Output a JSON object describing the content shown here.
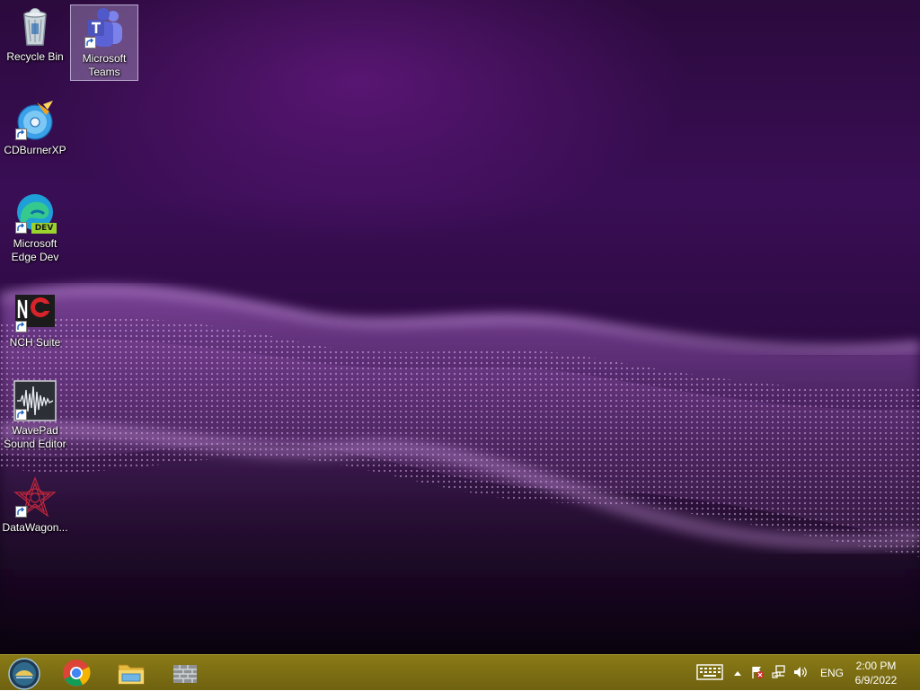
{
  "desktop": {
    "icons": [
      {
        "label": "Recycle Bin",
        "icon": "recycle-bin-icon"
      },
      {
        "label": "Microsoft Teams",
        "icon": "microsoft-teams-icon",
        "selected": true
      },
      {
        "label": "CDBurnerXP",
        "icon": "cdburnerxp-icon"
      },
      {
        "label": "Microsoft Edge Dev",
        "icon": "edge-dev-icon",
        "badge": "DEV"
      },
      {
        "label": "NCH Suite",
        "icon": "nch-suite-icon"
      },
      {
        "label": "WavePad Sound Editor",
        "icon": "wavepad-icon"
      },
      {
        "label": "DataWagon...",
        "icon": "datawagon-icon"
      }
    ]
  },
  "taskbar": {
    "start_icon": "start-orb-icon",
    "pinned": [
      {
        "name": "Google Chrome",
        "icon": "chrome-icon"
      },
      {
        "name": "File Explorer",
        "icon": "file-explorer-icon"
      },
      {
        "name": "Firewall",
        "icon": "wall-icon"
      }
    ],
    "tray": {
      "keyboard_icon": "touch-keyboard-icon",
      "show_hidden_icon": "chevron-up-icon",
      "action_center_icon": "flag-alert-icon",
      "network_icon": "network-icon",
      "volume_icon": "speaker-icon",
      "language": "ENG",
      "time": "2:00 PM",
      "date": "6/9/2022"
    },
    "colors": {
      "bar": "#7d6e13"
    }
  }
}
